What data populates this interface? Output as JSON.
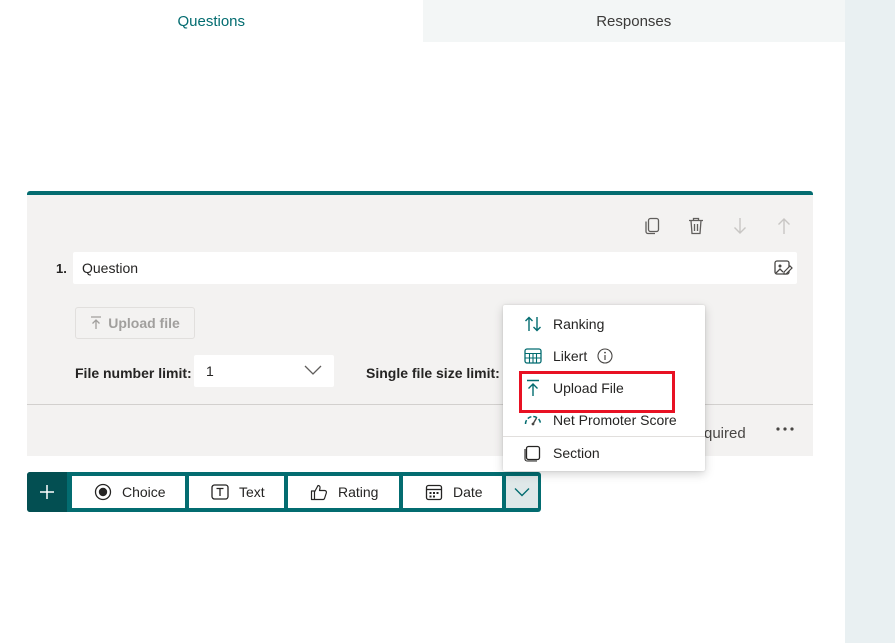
{
  "tabs": [
    {
      "label": "Questions",
      "active": true
    },
    {
      "label": "Responses",
      "active": false
    }
  ],
  "question": {
    "number": "1.",
    "placeholder": "Question",
    "upload_button": "Upload file",
    "file_number_limit_label": "File number limit:",
    "file_number_limit_value": "1",
    "single_file_size_label": "Single file size limit:",
    "required_label": "quired"
  },
  "add_bar": {
    "types": [
      {
        "label": "Choice",
        "icon": "radio-icon"
      },
      {
        "label": "Text",
        "icon": "text-box-icon"
      },
      {
        "label": "Rating",
        "icon": "thumb-up-icon"
      },
      {
        "label": "Date",
        "icon": "calendar-icon"
      }
    ]
  },
  "dropdown": {
    "items": [
      {
        "label": "Ranking",
        "icon": "sort-arrows-icon"
      },
      {
        "label": "Likert",
        "icon": "grid-icon",
        "info": true
      },
      {
        "label": "Upload File",
        "icon": "upload-icon"
      },
      {
        "label": "Net Promoter Score",
        "icon": "gauge-icon"
      },
      {
        "label": "Section",
        "icon": "section-icon"
      }
    ]
  },
  "colors": {
    "accent": "#036c70",
    "highlight": "#e81123"
  }
}
